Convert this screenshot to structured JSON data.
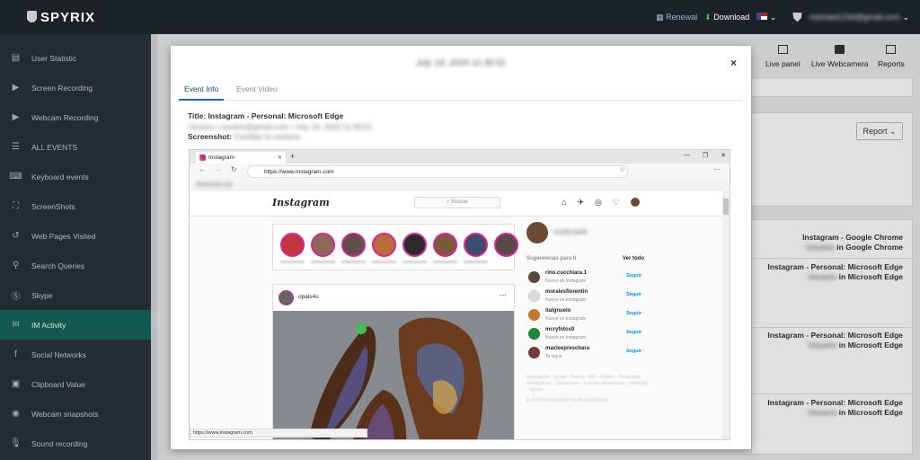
{
  "topbar": {
    "logo": "SPYRIX",
    "renewal": "Renewal",
    "download": "Download",
    "account": "michael1234@gmail.com"
  },
  "sidebar": {
    "items": [
      {
        "label": "User Statistic",
        "icon": "stats-icon"
      },
      {
        "label": "Screen Recording",
        "icon": "play-icon"
      },
      {
        "label": "Webcam Recording",
        "icon": "play-icon"
      },
      {
        "label": "ALL EVENTS",
        "icon": "list-icon"
      },
      {
        "label": "Keyboard events",
        "icon": "keyboard-icon"
      },
      {
        "label": "ScreenShots",
        "icon": "screenshot-icon"
      },
      {
        "label": "Web Pages Visited",
        "icon": "history-icon"
      },
      {
        "label": "Search Queries",
        "icon": "search-icon"
      },
      {
        "label": "Skype",
        "icon": "skype-icon"
      },
      {
        "label": "IM Activity",
        "icon": "chat-icon"
      },
      {
        "label": "Social Networks",
        "icon": "facebook-icon"
      },
      {
        "label": "Clipboard Value",
        "icon": "clipboard-icon"
      },
      {
        "label": "Webcam snapshots",
        "icon": "camera-icon"
      },
      {
        "label": "Sound recording",
        "icon": "mic-icon"
      }
    ],
    "active_index": 9
  },
  "toolbar": {
    "live_panel": "Live panel",
    "live_webcamera": "Live Webcamera",
    "reports": "Reports",
    "report_button": "Report ⌄"
  },
  "events": [
    {
      "title": "Instagram - Google Chrome",
      "user": "Usuario",
      "in": "in",
      "app": "Google Chrome"
    },
    {
      "title": "Instagram - Personal: Microsoft Edge",
      "user": "Usuario",
      "in": "in",
      "app": "Microsoft Edge"
    },
    {
      "title": "Instagram - Personal: Microsoft Edge",
      "user": "Usuario",
      "in": "in",
      "app": "Microsoft Edge"
    },
    {
      "title": "Instagram - Personal: Microsoft Edge",
      "user": "Usuario",
      "in": "in",
      "app": "Microsoft Edge"
    }
  ],
  "modal": {
    "title": "July 14, 2020 11:30:51",
    "close": "×",
    "tabs": [
      "Event Info",
      "Event Video"
    ],
    "info_title_label": "Title:",
    "info_title_value": "Instagram - Personal: Microsoft Edge",
    "info_user": "Usuario • usuario@gmail.com • July 14, 2020 11:30:51",
    "info_screenshot_label": "Screenshot:",
    "info_screenshot_value": "Cambiar la ventana"
  },
  "embedded": {
    "tab_title": "Instagram",
    "url": "https://www.instagram.com",
    "status_url": "https://www.instagram.com",
    "bookmarks": "Bookmarks bar",
    "ig_logo": "Instagram",
    "search_placeholder": "⌕ Buscar",
    "post_user": "opals4u",
    "me_name": "usuario.perfil",
    "suggestions_title": "Sugerencias para ti",
    "see_all": "Ver todo",
    "suggestions": [
      {
        "name": "rino.cucchiara.1",
        "sub": "Nuevo en Instagram",
        "follow": "Seguir",
        "color": "#5b4a3a"
      },
      {
        "name": "moralesflorentin",
        "sub": "Nuevo en Instagram",
        "follow": "Seguir",
        "color": "#dcdcdc"
      },
      {
        "name": "italgnuelo",
        "sub": "Nuevo en Instagram",
        "follow": "Seguir",
        "color": "#c07a2c"
      },
      {
        "name": "mcryfotos9",
        "sub": "Nuevo en Instagram",
        "follow": "Seguir",
        "color": "#1a8a3a"
      },
      {
        "name": "maxleepreschara",
        "sub": "Te sigue",
        "follow": "Seguir",
        "color": "#7a3a3a"
      }
    ],
    "footer": "Información · Ayuda · Prensa · API · Empleo · Privacidad · Condiciones · Ubicaciones · Cuentas destacadas · Hashtags · Idioma",
    "copyright": "© 2020 INSTAGRAM FROM FACEBOOK"
  }
}
